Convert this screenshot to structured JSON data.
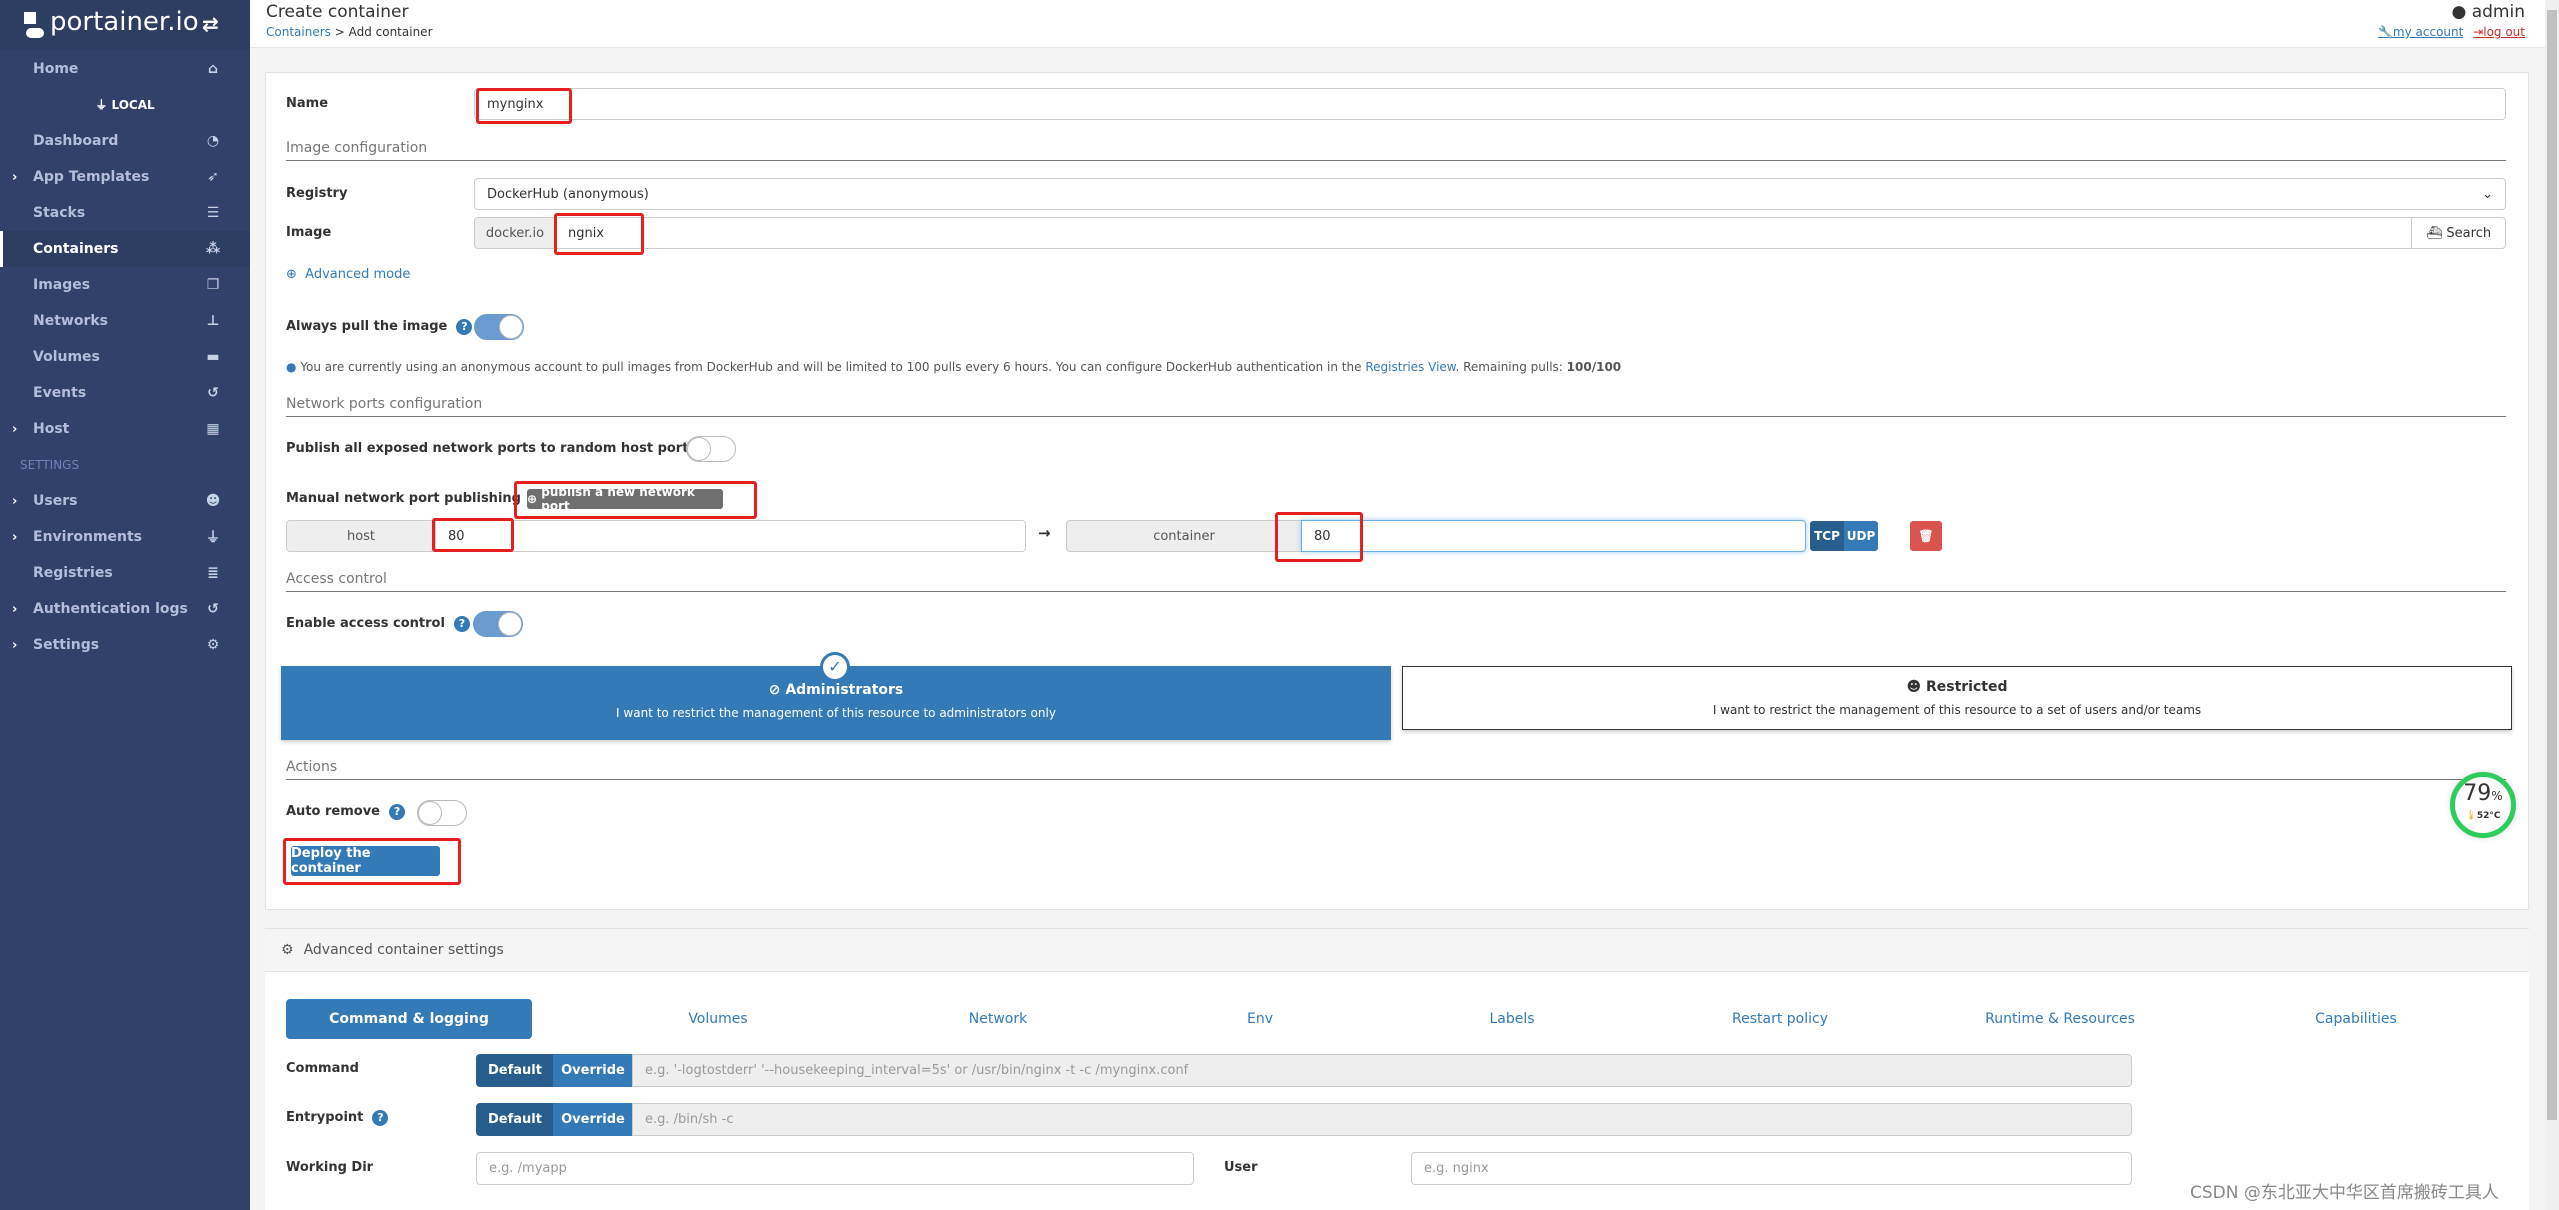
{
  "sidebar": {
    "brand": "portainer.io",
    "toggle_icon": "exchange-icon",
    "home": "Home",
    "environment": "LOCAL",
    "items": [
      {
        "label": "Dashboard",
        "icon": "dashboard-icon",
        "expandable": false
      },
      {
        "label": "App Templates",
        "icon": "rocket-icon",
        "expandable": true
      },
      {
        "label": "Stacks",
        "icon": "list-icon",
        "expandable": false
      },
      {
        "label": "Containers",
        "icon": "cubes-icon",
        "expandable": false,
        "active": true
      },
      {
        "label": "Images",
        "icon": "clone-icon",
        "expandable": false
      },
      {
        "label": "Networks",
        "icon": "sitemap-icon",
        "expandable": false
      },
      {
        "label": "Volumes",
        "icon": "hdd-icon",
        "expandable": false
      },
      {
        "label": "Events",
        "icon": "history-icon",
        "expandable": false
      },
      {
        "label": "Host",
        "icon": "th-icon",
        "expandable": true
      }
    ],
    "settings_heading": "SETTINGS",
    "settings_items": [
      {
        "label": "Users",
        "icon": "users-icon",
        "expandable": true
      },
      {
        "label": "Environments",
        "icon": "plug-icon",
        "expandable": true
      },
      {
        "label": "Registries",
        "icon": "database-icon",
        "expandable": false
      },
      {
        "label": "Authentication logs",
        "icon": "history-icon",
        "expandable": true
      },
      {
        "label": "Settings",
        "icon": "cogs-icon",
        "expandable": true
      }
    ]
  },
  "header": {
    "title": "Create container",
    "breadcrumb_link": "Containers",
    "breadcrumb_sep": " > ",
    "breadcrumb_current": "Add container",
    "username": "admin",
    "my_account": "my account",
    "log_out": "log out"
  },
  "form": {
    "name_label": "Name",
    "name_value": "mynginx",
    "image_section": "Image configuration",
    "registry_label": "Registry",
    "registry_value": "DockerHub (anonymous)",
    "image_label": "Image",
    "image_prefix": "docker.io",
    "image_value": "ngnix",
    "search_button": "Search",
    "advanced_mode": "Advanced mode",
    "always_pull_label": "Always pull the image",
    "always_pull": true,
    "info_text": "You are currently using an anonymous account to pull images from DockerHub and will be limited to 100 pulls every 6 hours. You can configure DockerHub authentication in the ",
    "info_link": "Registries View",
    "info_suffix": ". Remaining pulls: ",
    "info_pulls": "100/100",
    "network_section": "Network ports configuration",
    "publish_all_label": "Publish all exposed network ports to random host ports",
    "publish_all": false,
    "manual_label": "Manual network port publishing",
    "publish_new_button": "publish a new network port",
    "port_host_label": "host",
    "port_host_value": "80",
    "port_arrow": "→",
    "port_container_label": "container",
    "port_container_value": "80",
    "protocol_tcp": "TCP",
    "protocol_udp": "UDP",
    "access_section": "Access control",
    "access_label": "Enable access control",
    "access_enabled": true,
    "admin_title": "Administrators",
    "admin_desc": "I want to restrict the management of this resource to administrators only",
    "restricted_title": "Restricted",
    "restricted_desc": "I want to restrict the management of this resource to a set of users and/or teams",
    "actions_section": "Actions",
    "auto_remove_label": "Auto remove",
    "auto_remove": false,
    "deploy_button": "Deploy the container"
  },
  "advanced": {
    "title": "Advanced container settings",
    "tabs": [
      "Command & logging",
      "Volumes",
      "Network",
      "Env",
      "Labels",
      "Restart policy",
      "Runtime & Resources",
      "Capabilities"
    ],
    "active_tab": "Command & logging",
    "command_label": "Command",
    "entrypoint_label": "Entrypoint",
    "default_btn": "Default",
    "override_btn": "Override",
    "command_placeholder": "e.g. '-logtostderr' '--housekeeping_interval=5s' or /usr/bin/nginx -t -c /mynginx.conf",
    "entrypoint_placeholder": "e.g. /bin/sh -c",
    "workdir_label": "Working Dir",
    "workdir_placeholder": "e.g. /myapp",
    "user_label": "User",
    "user_placeholder": "e.g. nginx"
  },
  "widget": {
    "cpu_percent": "79",
    "percent_sign": "%",
    "temperature": "52°C"
  },
  "watermark": "CSDN @东北亚大中华区首席搬砖工具人",
  "colors": {
    "sidebar": "#30426a",
    "primary": "#337ab7",
    "danger": "#d9534f",
    "highlight": "#e61f1f"
  }
}
